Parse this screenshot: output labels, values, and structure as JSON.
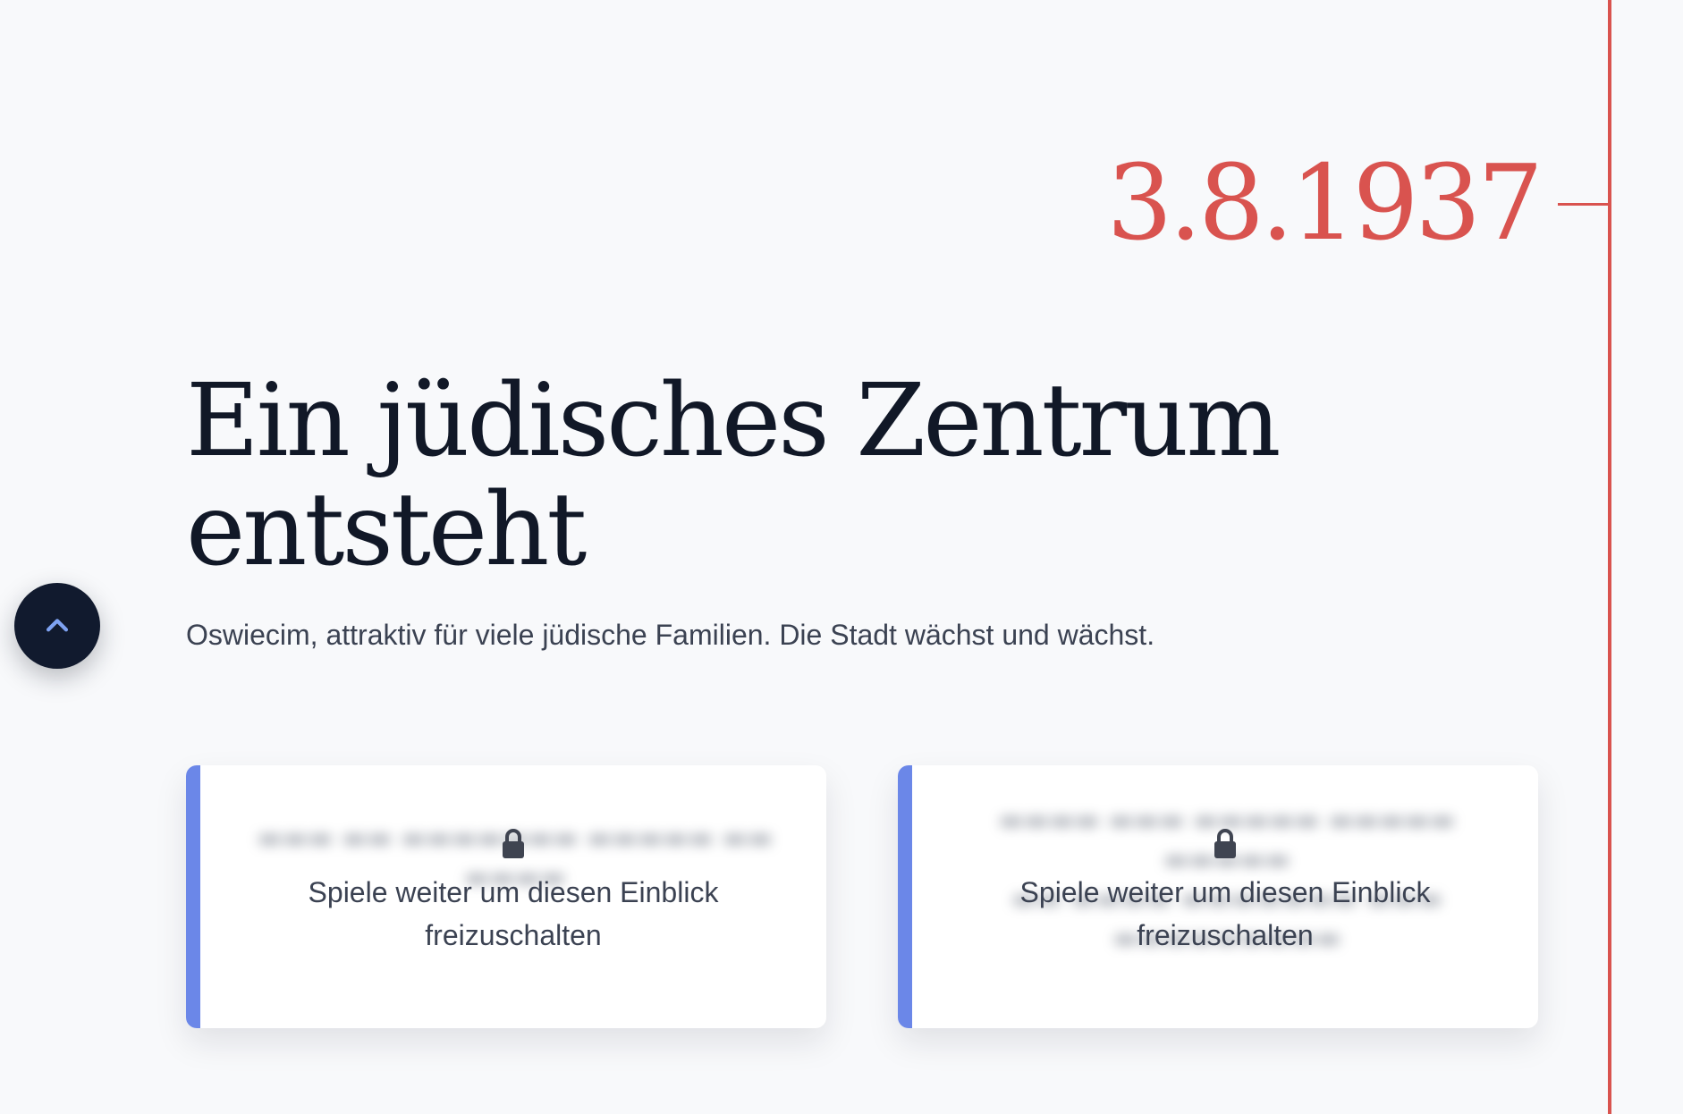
{
  "timeline": {
    "date": "3.8.1937",
    "accent_color": "#d9534f"
  },
  "headline": {
    "line1": "Ein jüdisches Zentrum",
    "line2": "entsteht"
  },
  "subtitle": "Oswiecim, attraktiv für viele jüdische Familien. Die Stadt wächst und wächst.",
  "back_to_top": {
    "icon": "chevron-up-icon"
  },
  "cards": [
    {
      "icon": "lock-icon",
      "message_line1": "Spiele weiter um diesen Einblick",
      "message_line2": "freizuschalten",
      "accent_color": "#6b87e8"
    },
    {
      "icon": "lock-icon",
      "message_line1": "Spiele weiter um diesen Einblick",
      "message_line2": "freizuschalten",
      "accent_color": "#6b87e8"
    }
  ]
}
